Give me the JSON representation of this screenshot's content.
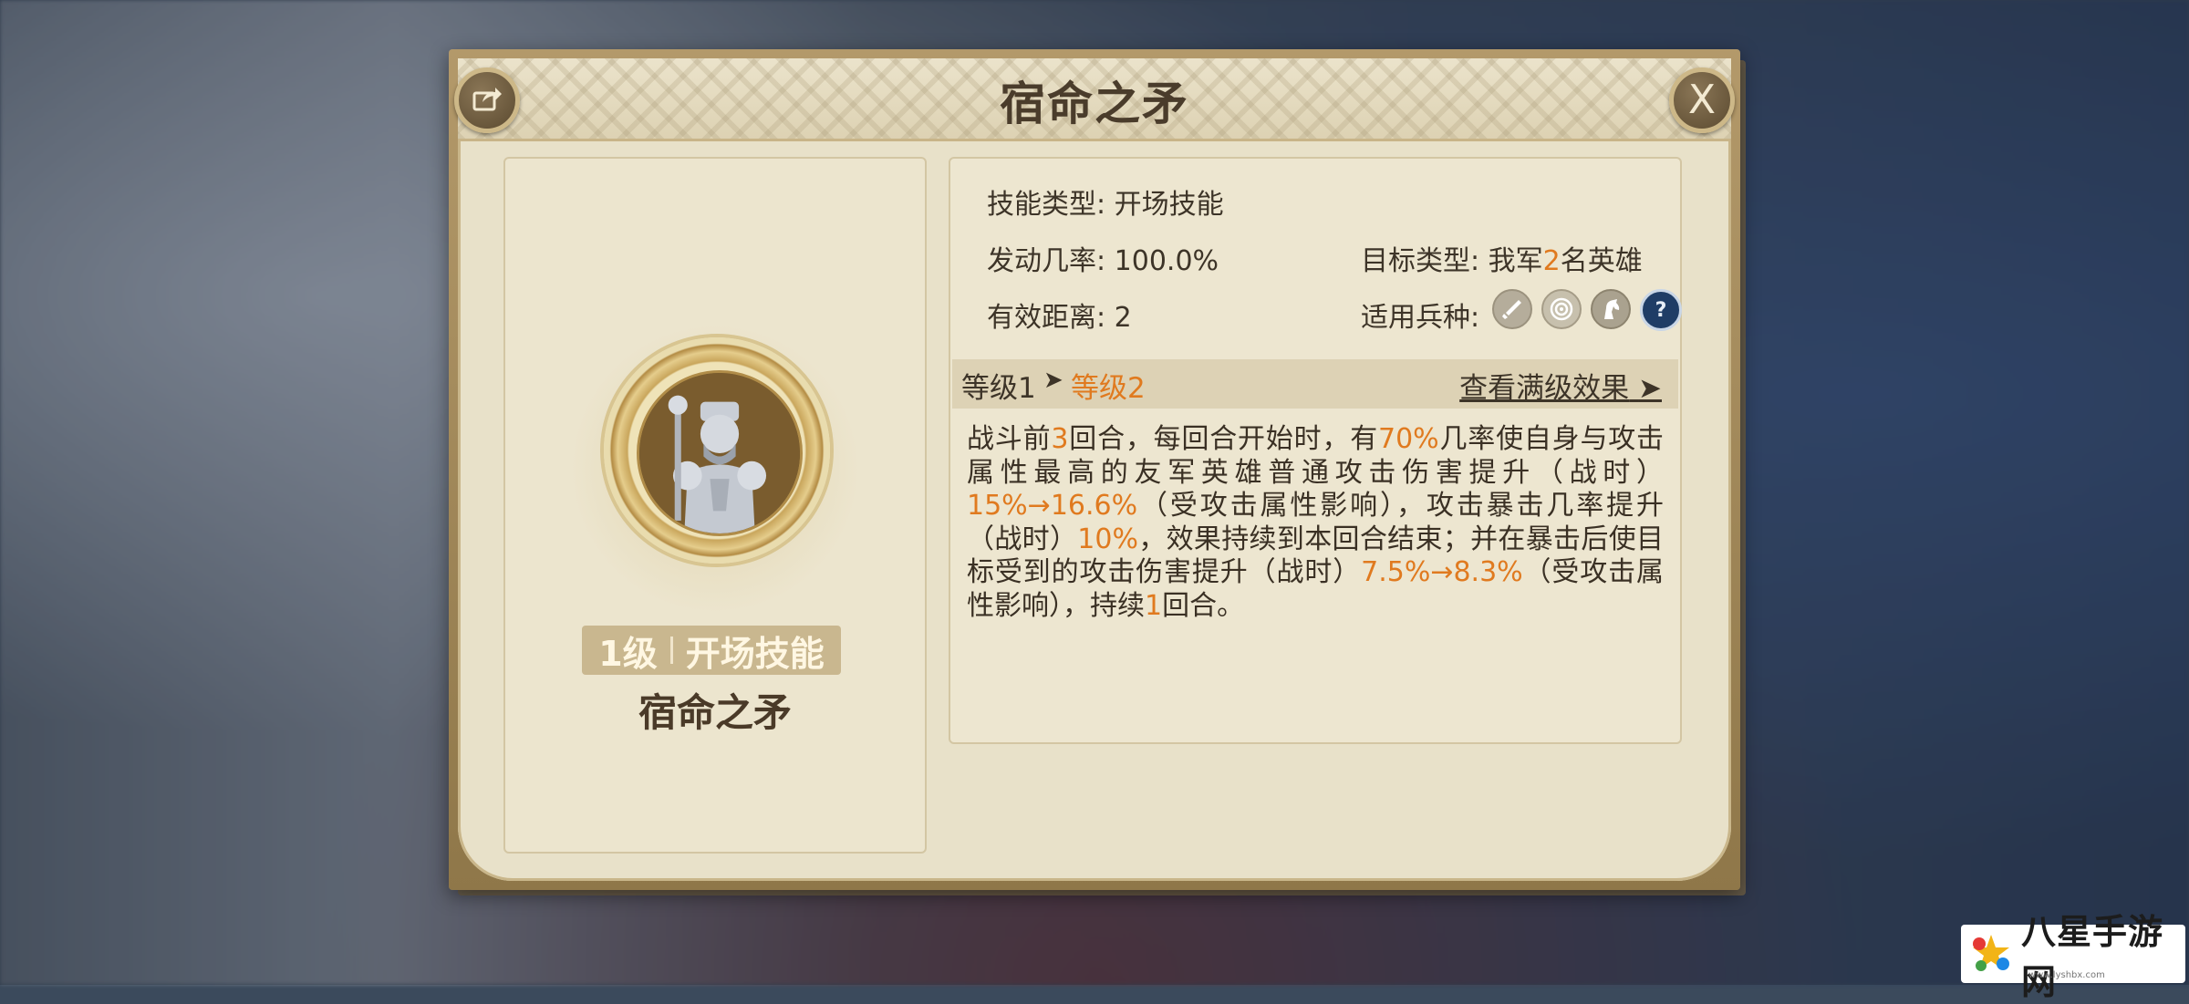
{
  "dialog": {
    "title": "宿命之矛",
    "share_icon": "share-icon",
    "close_label": "X"
  },
  "skill_card": {
    "level_text": "1级",
    "type_text": "开场技能",
    "name": "宿命之矛"
  },
  "info": {
    "skill_type_label": "技能类型:",
    "skill_type_value": "开场技能",
    "trigger_rate_label": "发动几率:",
    "trigger_rate_value": "100.0%",
    "range_label": "有效距离:",
    "range_value": "2",
    "target_label": "目标类型:",
    "target_prefix": "我军",
    "target_count": "2",
    "target_suffix": "名英雄",
    "troops_label": "适用兵种:",
    "troop_icons": [
      "sword-icon",
      "bow-target-icon",
      "horse-icon",
      "question-icon"
    ],
    "question_mark": "?"
  },
  "levels": {
    "from": "等级1",
    "arrow": "➤",
    "to": "等级2",
    "view_full": "查看满级效果",
    "view_full_arrow": "➤"
  },
  "description": {
    "p1": "战斗前",
    "n1": "3",
    "p2": "回合，每回合开始时，有",
    "n2": "70%",
    "p3": "几率使自身与攻击属性最高的友军英雄普通攻击伤害提升（战时）",
    "n3": "15%→16.6%",
    "p4": "（受攻击属性影响），攻击暴击几率提升（战时）",
    "n4": "10%",
    "p5": "，效果持续到本回合结束；并在暴击后使目标受到的攻击伤害提升（战时）",
    "n5": "7.5%→8.3%",
    "p6": "（受攻击属性影响），持续",
    "n6": "1",
    "p7": "回合。"
  },
  "colors": {
    "highlight": "#e07a1f",
    "parchment": "#e8e1c9",
    "frame": "#a58b5c"
  },
  "watermark": {
    "text": "八星手游网",
    "url": "www.lyshbx.com"
  }
}
